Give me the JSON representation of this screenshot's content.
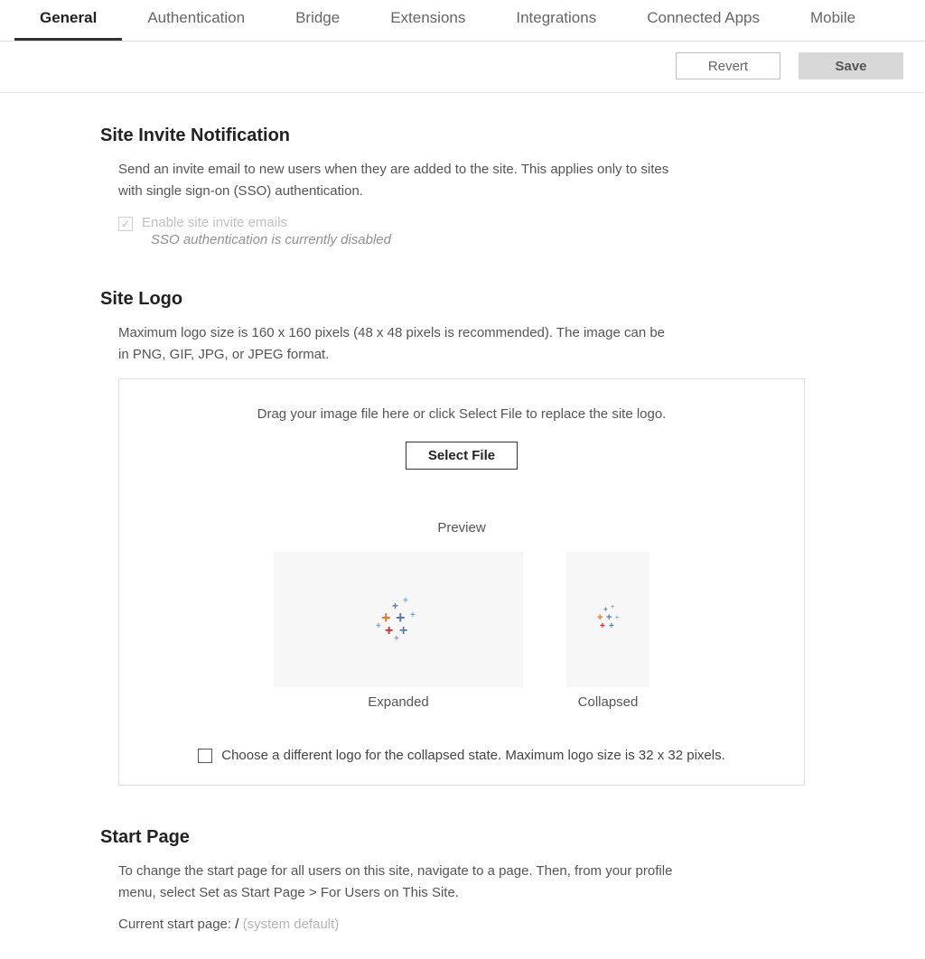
{
  "tabs": {
    "general": "General",
    "authentication": "Authentication",
    "bridge": "Bridge",
    "extensions": "Extensions",
    "integrations": "Integrations",
    "connected_apps": "Connected Apps",
    "mobile": "Mobile",
    "active": "general"
  },
  "actions": {
    "revert": "Revert",
    "save": "Save"
  },
  "site_invite": {
    "heading": "Site Invite Notification",
    "desc": "Send an invite email to new users when they are added to the site. This applies only to sites with single sign-on (SSO) authentication.",
    "checkbox_label": "Enable site invite emails",
    "checkbox_note": "SSO authentication is currently disabled"
  },
  "site_logo": {
    "heading": "Site Logo",
    "desc": "Maximum logo size is 160 x 160 pixels (48 x 48 pixels is recommended). The image can be in PNG, GIF, JPG, or JPEG format.",
    "drop_instr": "Drag your image file here or click Select File to replace the site logo.",
    "select_file": "Select File",
    "preview_label": "Preview",
    "expanded": "Expanded",
    "collapsed": "Collapsed",
    "diff_logo": "Choose a different logo for the collapsed state. Maximum logo size is 32 x 32 pixels."
  },
  "start_page": {
    "heading": "Start Page",
    "desc": "To change the start page for all users on this site, navigate to a page. Then, from your profile menu, select Set as Start Page > For Users on This Site.",
    "current_label": "Current start page:",
    "current_path": "/",
    "current_default": "(system default)"
  }
}
